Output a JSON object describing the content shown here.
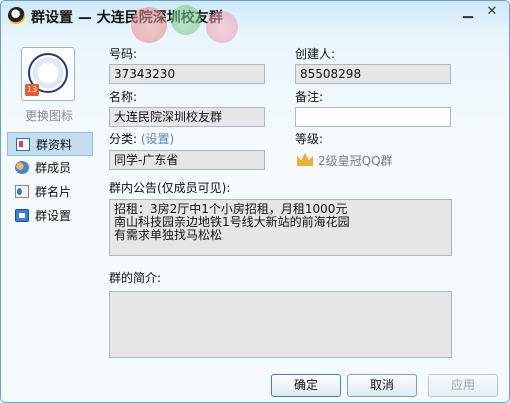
{
  "window": {
    "title": "群设置 — 大连民院深圳校友群",
    "minimize_glyph": "▁",
    "close_glyph": "✕"
  },
  "left_panel": {
    "avatar_badge": "13",
    "change_icon_label": "更换图标",
    "nav": [
      {
        "label": "群资料",
        "icon": "group-info-icon",
        "active": true
      },
      {
        "label": "群成员",
        "icon": "group-members-icon",
        "active": false
      },
      {
        "label": "群名片",
        "icon": "group-card-icon",
        "active": false
      },
      {
        "label": "群设置",
        "icon": "group-settings-icon",
        "active": false
      }
    ]
  },
  "form": {
    "number_label": "号码:",
    "number_value": "37343230",
    "creator_label": "创建人:",
    "creator_value": "85508298",
    "name_label": "名称:",
    "name_value": "大连民院深圳校友群",
    "note_label": "备注:",
    "note_value": "",
    "category_label": "分类:",
    "category_link": "(设置)",
    "category_value": "同学-广东省",
    "grade_label": "等级:",
    "grade_value": "2级皇冠QQ群",
    "announcement_label": "群内公告(仅成员可见):",
    "announcement_lines": [
      "招租：3房2厅中1个小房招租，月租1000元",
      "南山科技园亲边地铁1号线大新站的前海花园",
      "有需求单独找马松松"
    ],
    "intro_label": "群的简介:",
    "intro_value": ""
  },
  "buttons": {
    "ok": "确定",
    "cancel": "取消",
    "apply": "应用"
  },
  "colors": {
    "accent": "#3c7fc4",
    "nav_active_bg": "#c4ddf0",
    "link": "#5b84b9",
    "crown": "#e6b23a"
  }
}
